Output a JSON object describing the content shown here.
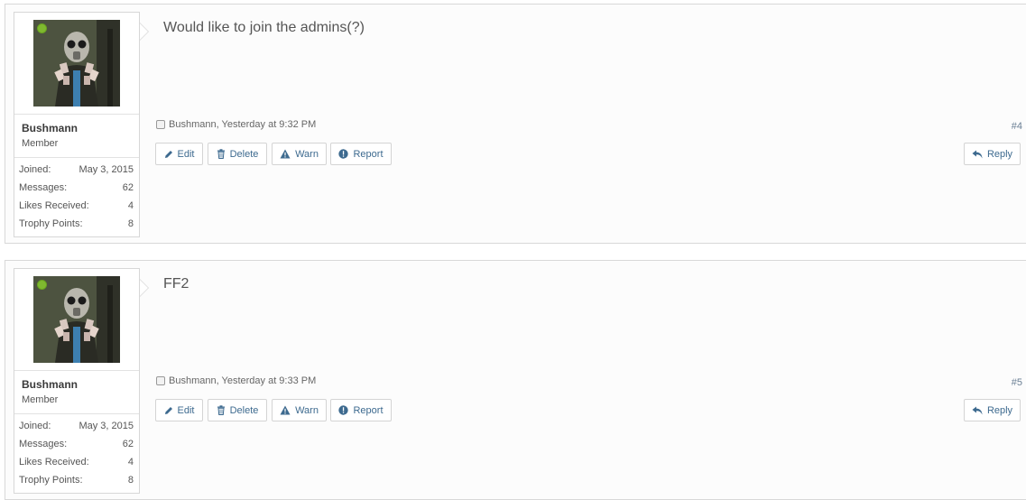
{
  "posts": [
    {
      "user": {
        "name": "Bushmann",
        "title": "Member",
        "online": true
      },
      "stats": [
        {
          "label": "Joined:",
          "value": "May 3, 2015"
        },
        {
          "label": "Messages:",
          "value": "62"
        },
        {
          "label": "Likes Received:",
          "value": "4"
        },
        {
          "label": "Trophy Points:",
          "value": "8"
        }
      ],
      "message": "Would like to join the admins(?)",
      "meta": "Bushmann, Yesterday at 9:32 PM",
      "number": "#4",
      "actions": {
        "edit": "Edit",
        "delete": "Delete",
        "warn": "Warn",
        "report": "Report",
        "reply": "Reply"
      }
    },
    {
      "user": {
        "name": "Bushmann",
        "title": "Member",
        "online": true
      },
      "stats": [
        {
          "label": "Joined:",
          "value": "May 3, 2015"
        },
        {
          "label": "Messages:",
          "value": "62"
        },
        {
          "label": "Likes Received:",
          "value": "4"
        },
        {
          "label": "Trophy Points:",
          "value": "8"
        }
      ],
      "message": "FF2",
      "meta": "Bushmann, Yesterday at 9:33 PM",
      "number": "#5",
      "actions": {
        "edit": "Edit",
        "delete": "Delete",
        "warn": "Warn",
        "report": "Report",
        "reply": "Reply"
      }
    }
  ],
  "icons": {
    "edit": "pencil-icon",
    "delete": "trash-icon",
    "warn": "warning-icon",
    "report": "info-circle-icon",
    "reply": "reply-arrow-icon"
  },
  "colors": {
    "link": "#3d6a8f",
    "online": "#7fb92f",
    "border": "#d8d8d8"
  }
}
